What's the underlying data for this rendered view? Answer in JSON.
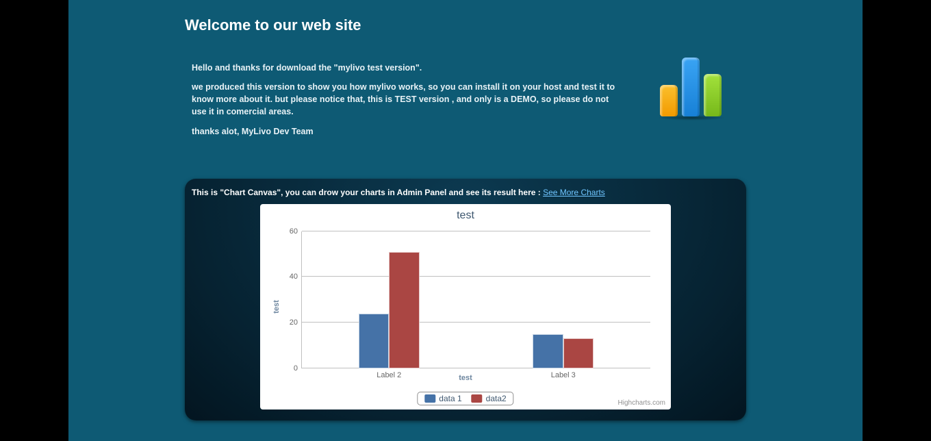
{
  "header": {
    "title": "Welcome to our web site"
  },
  "intro": {
    "p1": "Hello and thanks for download the \"mylivo test version\".",
    "p2": "we produced this version to show you how mylivo works, so you can install it on your host and test it to know more about it. but please notice that, this is TEST version , and only is a DEMO, so please do not use it in comercial areas.",
    "p3": "thanks alot, MyLivo Dev Team"
  },
  "section": {
    "label": "This is \"Chart Canvas\", you can drow your charts in Admin Panel and see its result here : ",
    "link_text": "See More Charts"
  },
  "chart_data": {
    "type": "bar",
    "title": "test",
    "xlabel": "test",
    "ylabel": "test",
    "ylim": [
      0,
      60
    ],
    "yticks": [
      0,
      20,
      40,
      60
    ],
    "categories": [
      "Label 2",
      "Label 3"
    ],
    "series": [
      {
        "name": "data 1",
        "color": "#4572A7",
        "values": [
          24,
          15
        ]
      },
      {
        "name": "data2",
        "color": "#AA4643",
        "values": [
          51,
          13
        ]
      }
    ],
    "credits": "Highcharts.com"
  }
}
